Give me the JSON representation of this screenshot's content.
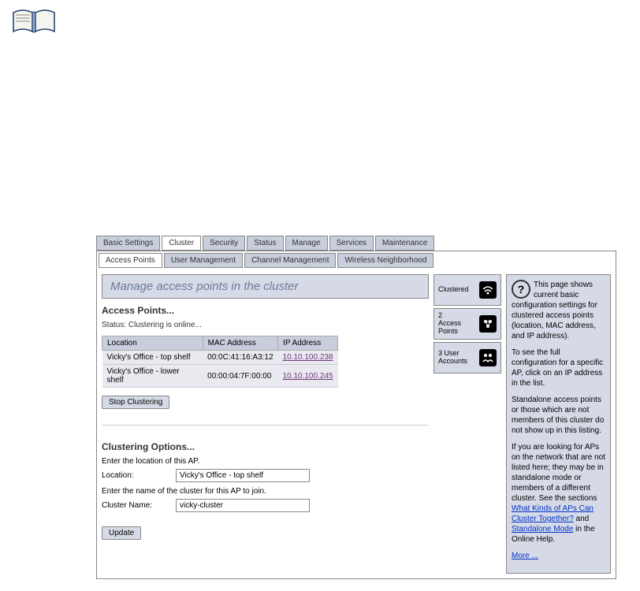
{
  "tabs": {
    "basic": "Basic Settings",
    "cluster": "Cluster",
    "security": "Security",
    "status": "Status",
    "manage": "Manage",
    "services": "Services",
    "maintenance": "Maintenance"
  },
  "subtabs": {
    "ap": "Access Points",
    "user": "User Management",
    "channel": "Channel Management",
    "wireless": "Wireless Neighborhood"
  },
  "page": {
    "title": "Manage access points in the cluster",
    "ap_heading": "Access Points...",
    "status_text": "Status: Clustering is online...",
    "stop_btn": "Stop Clustering",
    "options_heading": "Clustering Options...",
    "location_prompt": "Enter the location of this AP.",
    "location_label": "Location:",
    "location_value": "Vicky's Office - top shelf",
    "cluster_prompt": "Enter the name of the cluster for this AP to join.",
    "cluster_label": "Cluster Name:",
    "cluster_value": "vicky-cluster",
    "update_btn": "Update"
  },
  "table": {
    "headers": {
      "location": "Location",
      "mac": "MAC Address",
      "ip": "IP Address"
    },
    "rows": [
      {
        "location": "Vicky's Office - top shelf",
        "mac": "00:0C:41:16:A3:12",
        "ip": "10.10.100.238"
      },
      {
        "location": "Vicky's Office - lower shelf",
        "mac": "00:00:04:7F:00:00",
        "ip": "10.10.100.245"
      }
    ]
  },
  "sidebar": {
    "clustered": "Clustered",
    "ap_count": "2",
    "ap_label": "Access\nPoints",
    "user_count": "3 User",
    "user_label": "Accounts"
  },
  "help": {
    "p1": "This page shows current basic configuration settings for clustered access points (location, MAC address, and IP address).",
    "p2": "To see the full configuration for a specific AP, click on an IP address in the list.",
    "p3": "Standalone access points or those which are not members of this cluster do not show up in this listing.",
    "p4a": "If you are looking for APs on the network that are not listed here; they may be in standalone mode or members of a different cluster. See the sections ",
    "link1": "What Kinds of APs Can Cluster Together?",
    "p4b": " and ",
    "link2": "Standalone Mode",
    "p4c": " in the Online Help.",
    "more": "More ..."
  }
}
